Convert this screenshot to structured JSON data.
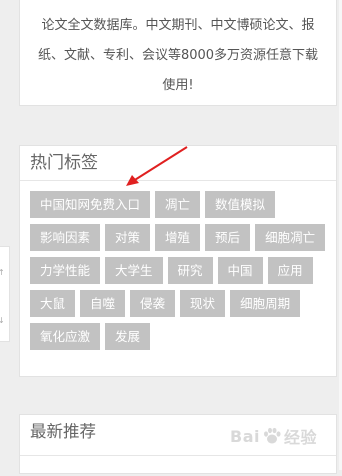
{
  "intro": {
    "lines": [
      "论文全文数据库。中文期刊、中文博硕论文、报",
      "纸、文献、专利、会议等8000多万资源任意下载",
      "使用!"
    ]
  },
  "hot_tags": {
    "title": "热门标签",
    "tags": [
      "中国知网免费入口",
      "凋亡",
      "数值模拟",
      "影响因素",
      "对策",
      "增殖",
      "预后",
      "细胞凋亡",
      "力学性能",
      "大学生",
      "研究",
      "中国",
      "应用",
      "大鼠",
      "自噬",
      "侵袭",
      "现状",
      "细胞周期",
      "氧化应激",
      "发展"
    ]
  },
  "latest": {
    "title": "最新推荐"
  },
  "side_widget": {
    "up_glyph": "↑",
    "down_glyph": "↓"
  },
  "watermark": {
    "text": "Bai",
    "text2": "经验"
  },
  "colors": {
    "tag_bg": "#c2c2c2",
    "annotation_arrow": "#e02020"
  }
}
